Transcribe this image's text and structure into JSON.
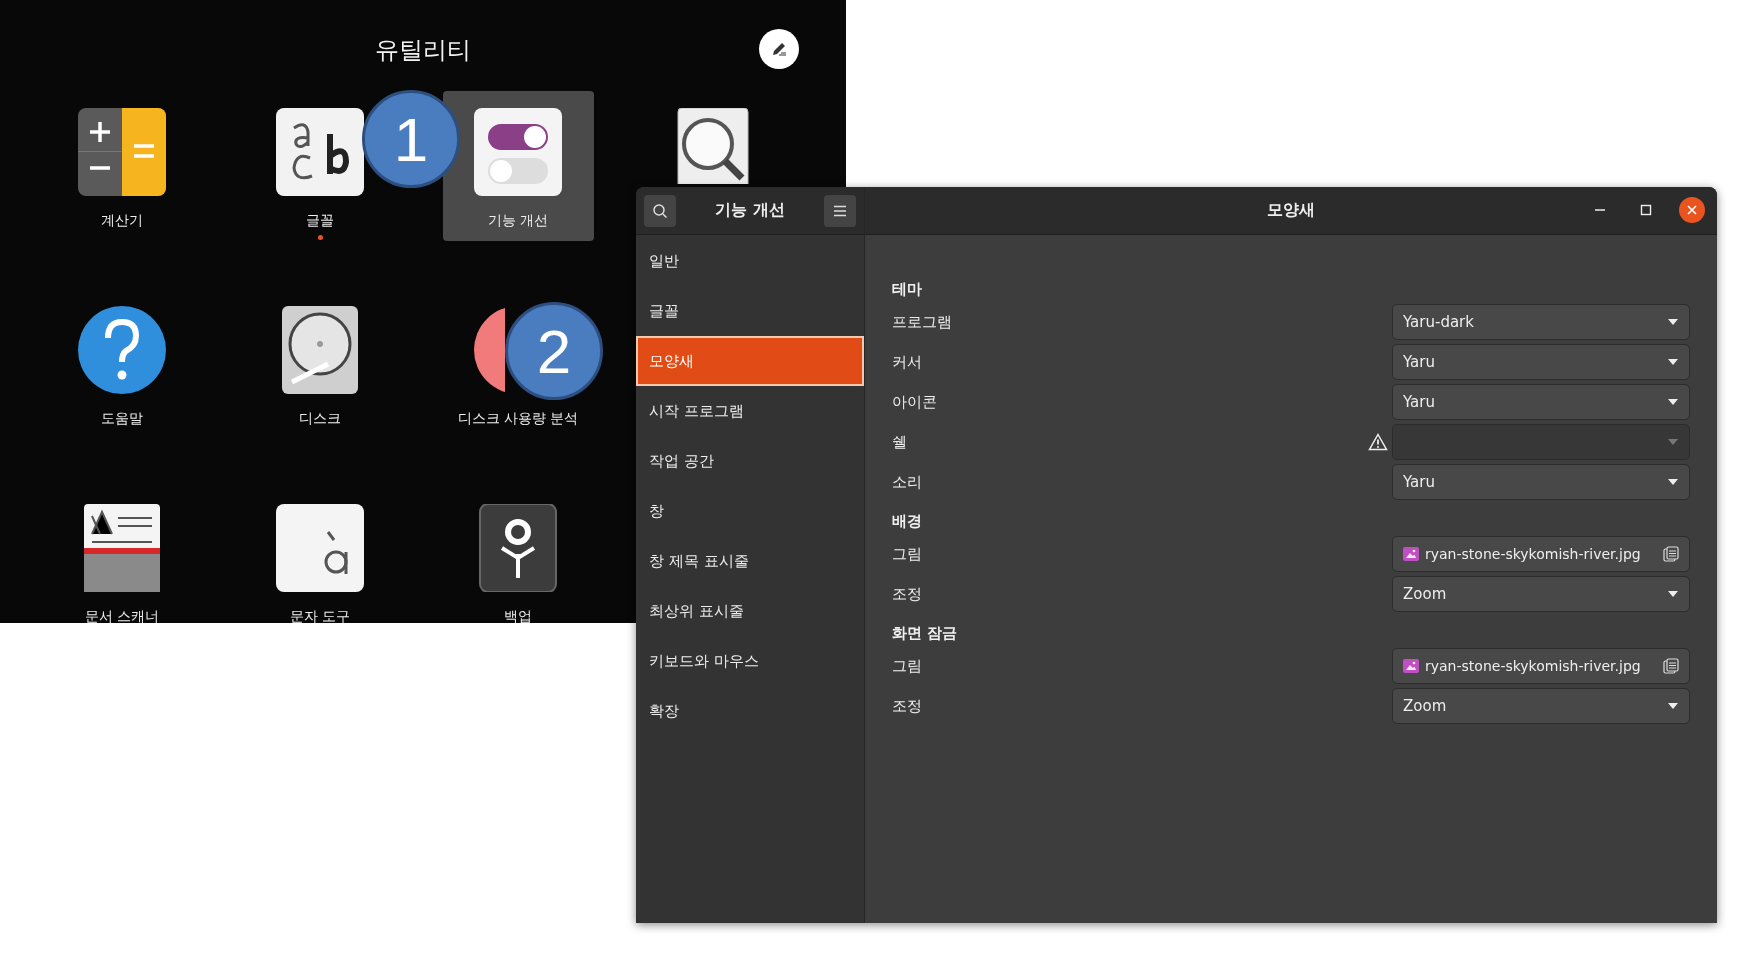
{
  "launcher": {
    "folder_title": "유틸리티",
    "apps": [
      {
        "label": "계산기",
        "kind": "calculator",
        "selected": false,
        "running": false
      },
      {
        "label": "글꼴",
        "kind": "fonts",
        "selected": false,
        "running": true
      },
      {
        "label": "기능 개선",
        "kind": "tweaks",
        "selected": true,
        "running": false
      },
      {
        "kind": "viewer",
        "selected": false,
        "running": false
      },
      {
        "label": "도움말",
        "kind": "help",
        "selected": false,
        "running": false
      },
      {
        "label": "디스크",
        "kind": "disk",
        "selected": false,
        "running": false
      },
      {
        "label": "디스크 사용량 분석",
        "kind": "usage",
        "selected": false,
        "running": false
      },
      {
        "kind": "none"
      },
      {
        "label": "문서 스캐너",
        "kind": "scanner",
        "selected": false,
        "running": false
      },
      {
        "label": "문자 도구",
        "kind": "characters",
        "selected": false,
        "running": false
      },
      {
        "label": "백업",
        "kind": "backup",
        "selected": false,
        "running": false
      }
    ]
  },
  "callouts": [
    {
      "label": "1"
    },
    {
      "label": "2"
    }
  ],
  "window": {
    "sidebar_title": "기능 개선",
    "title": "모양새",
    "nav": [
      {
        "label": "일반",
        "selected": false
      },
      {
        "label": "글꼴",
        "selected": false
      },
      {
        "label": "모양새",
        "selected": true
      },
      {
        "label": "시작 프로그램",
        "selected": false
      },
      {
        "label": "작업 공간",
        "selected": false
      },
      {
        "label": "창",
        "selected": false
      },
      {
        "label": "창 제목 표시줄",
        "selected": false
      },
      {
        "label": "최상위 표시줄",
        "selected": false
      },
      {
        "label": "키보드와 마우스",
        "selected": false
      },
      {
        "label": "확장",
        "selected": false
      }
    ],
    "sections": [
      {
        "heading": "테마",
        "rows": [
          {
            "label": "프로그램",
            "kind": "dropdown",
            "value": "Yaru-dark",
            "disabled": false,
            "warning": false
          },
          {
            "label": "커서",
            "kind": "dropdown",
            "value": "Yaru",
            "disabled": false,
            "warning": false
          },
          {
            "label": "아이콘",
            "kind": "dropdown",
            "value": "Yaru",
            "disabled": false,
            "warning": false
          },
          {
            "label": "쉘",
            "kind": "dropdown",
            "disabled": true,
            "warning": true
          },
          {
            "label": "소리",
            "kind": "dropdown",
            "value": "Yaru",
            "disabled": false,
            "warning": false
          }
        ]
      },
      {
        "heading": "배경",
        "rows": [
          {
            "label": "그림",
            "kind": "file",
            "value": "ryan-stone-skykomish-river.jpg"
          },
          {
            "label": "조정",
            "kind": "dropdown",
            "value": "Zoom",
            "disabled": false,
            "warning": false
          }
        ]
      },
      {
        "heading": "화면 잠금",
        "rows": [
          {
            "label": "그림",
            "kind": "file",
            "value": "ryan-stone-skykomish-river.jpg"
          },
          {
            "label": "조정",
            "kind": "dropdown",
            "value": "Zoom",
            "disabled": false,
            "warning": false
          }
        ]
      }
    ]
  }
}
